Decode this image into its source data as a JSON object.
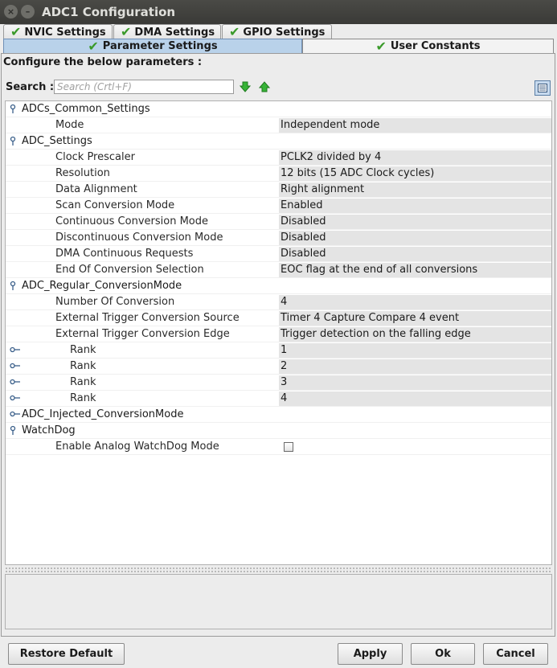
{
  "window": {
    "title": "ADC1 Configuration",
    "close_glyph": "×",
    "min_glyph": "–"
  },
  "tabs_top": [
    {
      "label": "NVIC Settings",
      "checked": true
    },
    {
      "label": "DMA Settings",
      "checked": true
    },
    {
      "label": "GPIO Settings",
      "checked": true
    }
  ],
  "tabs_second": [
    {
      "label": "Parameter Settings",
      "checked": true,
      "active": true
    },
    {
      "label": "User Constants",
      "checked": true,
      "active": false
    }
  ],
  "check_glyph": "✔",
  "panel": {
    "configure_label": "Configure the below parameters :",
    "search_label": "Search :",
    "search_placeholder": "Search (Crtl+F)",
    "search_value": ""
  },
  "tree": {
    "groups": [
      {
        "name": "ADCs_Common_Settings",
        "expanded": true
      },
      {
        "name": "ADC_Settings",
        "expanded": true
      },
      {
        "name": "ADC_Regular_ConversionMode",
        "expanded": true
      },
      {
        "name": "ADC_Injected_ConversionMode",
        "expanded": false
      },
      {
        "name": "WatchDog",
        "expanded": true
      }
    ],
    "common": [
      {
        "name": "Mode",
        "value": "Independent mode"
      }
    ],
    "adc_settings": [
      {
        "name": "Clock Prescaler",
        "value": "PCLK2 divided by 4"
      },
      {
        "name": "Resolution",
        "value": "12 bits (15 ADC Clock cycles)"
      },
      {
        "name": "Data Alignment",
        "value": "Right alignment"
      },
      {
        "name": "Scan Conversion Mode",
        "value": "Enabled"
      },
      {
        "name": "Continuous Conversion Mode",
        "value": "Disabled"
      },
      {
        "name": "Discontinuous Conversion Mode",
        "value": "Disabled"
      },
      {
        "name": "DMA Continuous Requests",
        "value": "Disabled"
      },
      {
        "name": "End Of Conversion Selection",
        "value": "EOC flag at the end of all conversions"
      }
    ],
    "regular": [
      {
        "name": "Number Of Conversion",
        "value": "4"
      },
      {
        "name": "External Trigger Conversion Source",
        "value": "Timer 4 Capture Compare 4 event"
      },
      {
        "name": "External Trigger Conversion Edge",
        "value": "Trigger detection on the falling edge"
      }
    ],
    "ranks": [
      {
        "name": "Rank",
        "value": "1"
      },
      {
        "name": "Rank",
        "value": "2"
      },
      {
        "name": "Rank",
        "value": "3"
      },
      {
        "name": "Rank",
        "value": "4"
      }
    ],
    "watchdog": [
      {
        "name": "Enable Analog WatchDog Mode",
        "checked": false
      }
    ]
  },
  "buttons": {
    "restore_default": "Restore Default",
    "apply": "Apply",
    "ok": "Ok",
    "cancel": "Cancel"
  },
  "colors": {
    "titlebar": "#3c3c39",
    "check_green": "#3a9a2a",
    "active_tab": "#b9d2ea",
    "value_cell": "#e4e4e4",
    "arrow_green": "#2fa42f"
  }
}
